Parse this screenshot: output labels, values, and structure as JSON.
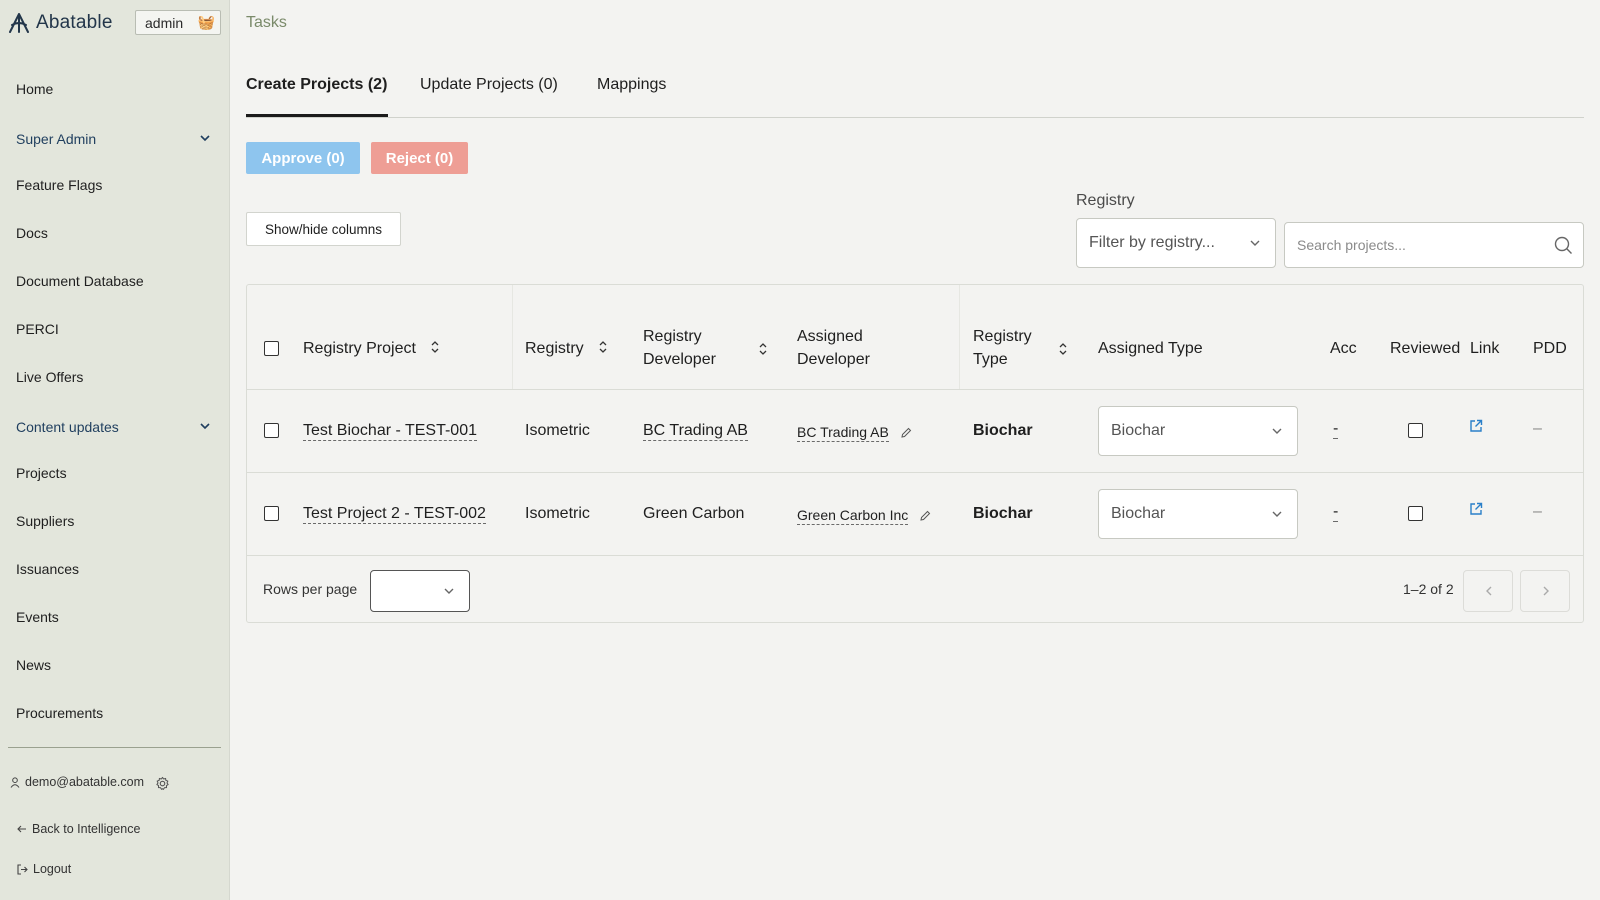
{
  "sidebar": {
    "brand": "Abatable",
    "admin_badge": "admin",
    "admin_emoji": "🧺",
    "items": [
      {
        "label": "Home"
      },
      {
        "label": "Super Admin"
      },
      {
        "label": "Feature Flags"
      },
      {
        "label": "Docs"
      },
      {
        "label": "Document Database"
      },
      {
        "label": "PERCI"
      },
      {
        "label": "Live Offers"
      },
      {
        "label": "Content updates"
      },
      {
        "label": "Projects"
      },
      {
        "label": "Suppliers"
      },
      {
        "label": "Issuances"
      },
      {
        "label": "Events"
      },
      {
        "label": "News"
      },
      {
        "label": "Procurements"
      }
    ],
    "user_email": "demo@abatable.com",
    "back_label": "Back to Intelligence",
    "logout_label": "Logout"
  },
  "header": {
    "title": "Tasks"
  },
  "tabs": [
    {
      "label": "Create Projects (2)",
      "active": true
    },
    {
      "label": "Update Projects (0)",
      "active": false
    },
    {
      "label": "Mappings",
      "active": false
    }
  ],
  "actions": {
    "approve_label": "Approve (0)",
    "reject_label": "Reject (0)",
    "showhide_label": "Show/hide columns"
  },
  "filters": {
    "registry_label": "Registry",
    "registry_placeholder": "Filter by registry...",
    "search_placeholder": "Search projects..."
  },
  "table": {
    "columns": {
      "registry_project": "Registry Project",
      "registry": "Registry",
      "registry_developer": [
        "Registry",
        "Developer"
      ],
      "assigned_developer": [
        "Assigned",
        "Developer"
      ],
      "registry_type": [
        "Registry",
        "Type"
      ],
      "assigned_type": "Assigned Type",
      "acc": "Acc",
      "reviewed": "Reviewed",
      "link": "Link",
      "pdd": "PDD"
    },
    "rows": [
      {
        "project": "Test Biochar - TEST-001",
        "registry": "Isometric",
        "registry_developer": "BC Trading AB",
        "assigned_developer": "BC Trading AB",
        "registry_type": "Biochar",
        "assigned_type": "Biochar",
        "acc": "-",
        "pdd": "–"
      },
      {
        "project": "Test Project 2 - TEST-002",
        "registry": "Isometric",
        "registry_developer": "Green Carbon",
        "assigned_developer": "Green Carbon Inc",
        "registry_type": "Biochar",
        "assigned_type": "Biochar",
        "acc": "-",
        "pdd": "–"
      }
    ],
    "footer": {
      "rows_per_page_label": "Rows per page",
      "range": "1–2 of 2"
    }
  },
  "colors": {
    "sidebar_bg": "#e3e6dc",
    "approve": "#8ec5ee",
    "reject": "#ee9e95",
    "link_icon": "#2a7fc9",
    "title": "#7a8a6a"
  }
}
